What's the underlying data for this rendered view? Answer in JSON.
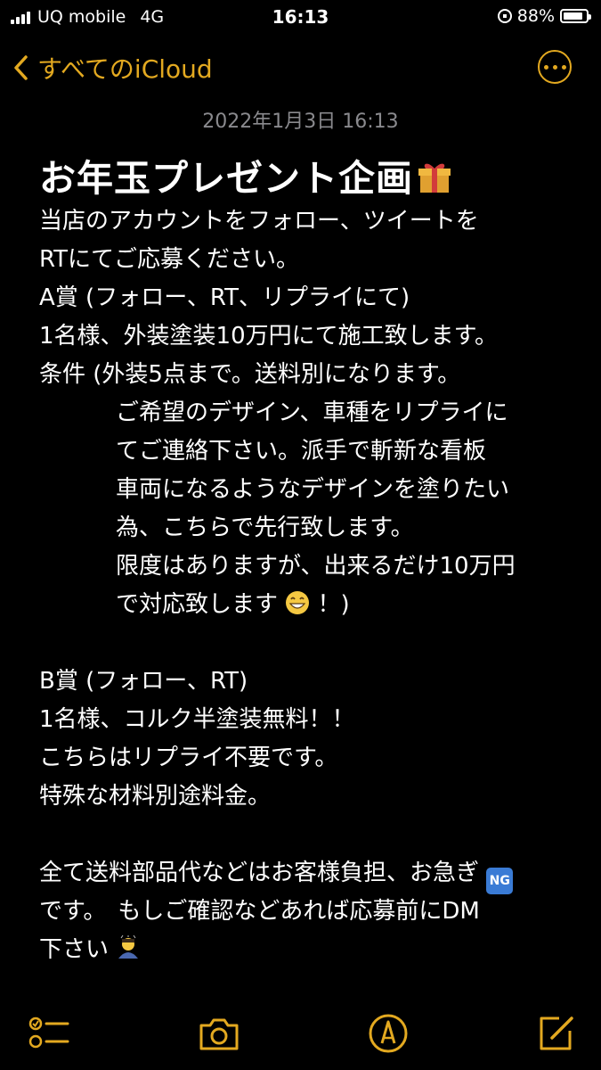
{
  "status": {
    "carrier": "UQ mobile",
    "network": "4G",
    "time": "16:13",
    "battery": "88%",
    "battery_level": 0.88
  },
  "nav": {
    "back_label": "すべてのiCloud",
    "accent": "#e3a920"
  },
  "note": {
    "timestamp": "2022年1月3日 16:13",
    "title": "お年玉プレゼント企画",
    "lines": [
      "当店のアカウントをフォロー、ツイートを",
      "RTにてご応募ください。",
      "A賞 (フォロー、RT、リプライにて)",
      "1名様、外装塗装10万円にて施工致します。",
      "条件 (外装5点まで。送料別になります。",
      "ご希望のデザイン、車種をリプライに",
      "てご連絡下さい。派手で斬新な看板",
      "車両になるようなデザインを塗りたい",
      "為、こちらで先行致します。",
      "限度はありますが、出来るだけ10万円",
      "で対応致します",
      "！)",
      "B賞 (フォロー、RT)",
      "1名様、コルク半塗装無料！！",
      "こちらはリプライ不要です。",
      "特殊な材料別途料金。",
      "全て送料部品代などはお客様負担、お急ぎ",
      "です。　もしご確認などあれば応募前にDM",
      "下さい"
    ],
    "ng_badge": "NG"
  },
  "toolbar": {
    "icons": [
      "checklist-icon",
      "camera-icon",
      "markup-icon",
      "compose-icon"
    ]
  }
}
